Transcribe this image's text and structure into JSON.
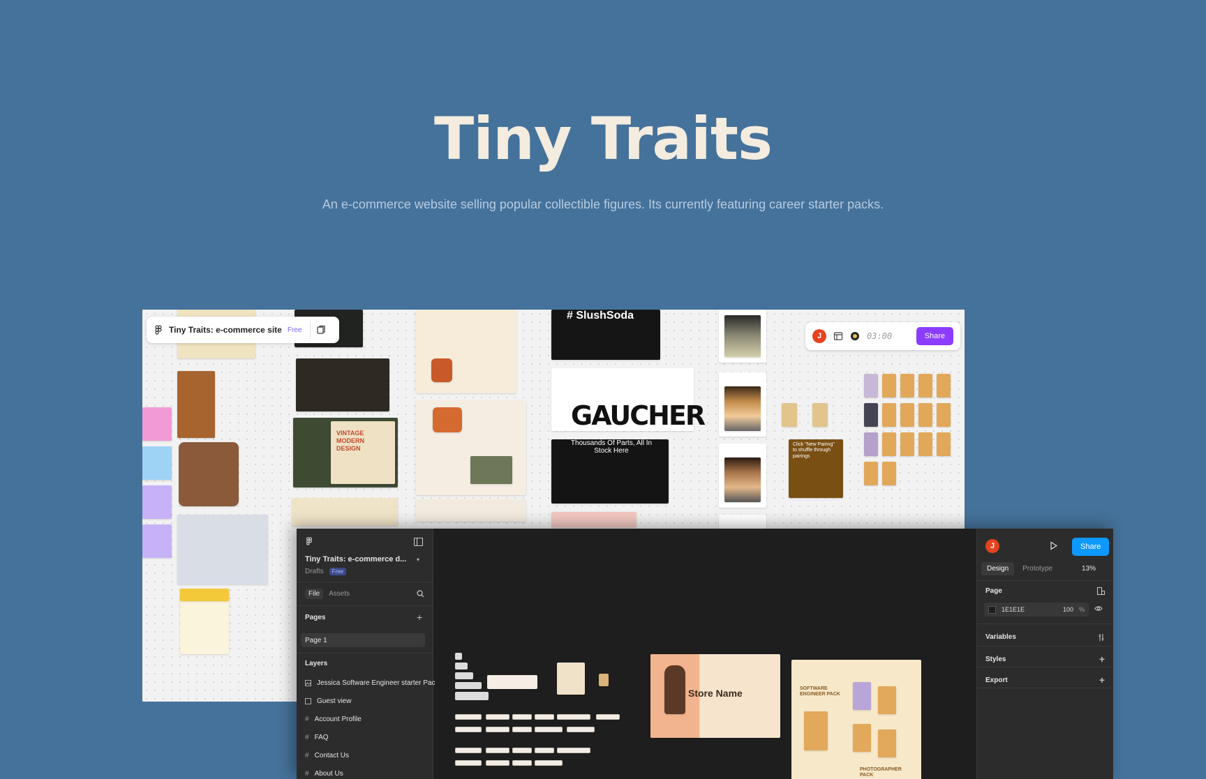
{
  "hero": {
    "title": "Tiny Traits",
    "subtitle": "An e-commerce website selling popular collectible figures. Its currently featuring career starter packs."
  },
  "back_window": {
    "file_name": "Tiny Traits: e-commerce site",
    "plan_badge": "Free",
    "timer": "03:00",
    "share_label": "Share",
    "avatar_initial": "J",
    "canvas_texts": {
      "slushsoda": "# SlushSoda",
      "gaucher": "GAUCHER",
      "thousands": "Thousands Of Parts, All In Stock Here",
      "vintage": "VINTAGE MODERN DESIGN",
      "click_note": "Click \"New Pairing\" to shuffle through pairings"
    }
  },
  "front_window": {
    "file_name": "Tiny Traits: e-commerce d...",
    "location": "Drafts",
    "plan_badge": "Free",
    "tabs": [
      "File",
      "Assets"
    ],
    "pages_label": "Pages",
    "current_page": "Page 1",
    "layers_label": "Layers",
    "layers": [
      {
        "name": "Jessica Software Engineer starter Pac",
        "icon": "image-icon"
      },
      {
        "name": "Guest view",
        "icon": "frame-icon"
      },
      {
        "name": "Account Profile",
        "icon": "grid-icon"
      },
      {
        "name": "FAQ",
        "icon": "grid-icon"
      },
      {
        "name": "Contact Us",
        "icon": "grid-icon"
      },
      {
        "name": "About Us",
        "icon": "grid-icon"
      }
    ],
    "right": {
      "avatar_initial": "J",
      "share_label": "Share",
      "tabs": [
        "Design",
        "Prototype"
      ],
      "zoom": "13%",
      "page_label": "Page",
      "page_color": "1E1E1E",
      "page_opacity": "100",
      "percent_sign": "%",
      "sections": [
        "Variables",
        "Styles",
        "Export"
      ]
    },
    "canvas_texts": {
      "store_name": "Store Name",
      "software_pack": "SOFTWARE ENGINEER PACK",
      "photographer_pack": "PHOTOGRAPHER PACK"
    }
  }
}
